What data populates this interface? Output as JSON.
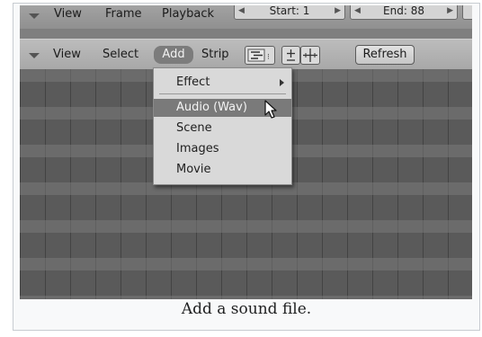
{
  "top_bar": {
    "menus": [
      "View",
      "Frame",
      "Playback"
    ],
    "start_field": "Start: 1",
    "end_field": "End: 88"
  },
  "header": {
    "menus": [
      "View",
      "Select",
      "Add",
      "Strip"
    ],
    "refresh_label": "Refresh"
  },
  "add_menu": {
    "items": [
      {
        "label": "Effect",
        "has_submenu": true
      },
      {
        "label": "Audio (Wav)",
        "highlighted": true
      },
      {
        "label": "Scene"
      },
      {
        "label": "Images"
      },
      {
        "label": "Movie"
      }
    ]
  },
  "caption": "Add a sound file."
}
